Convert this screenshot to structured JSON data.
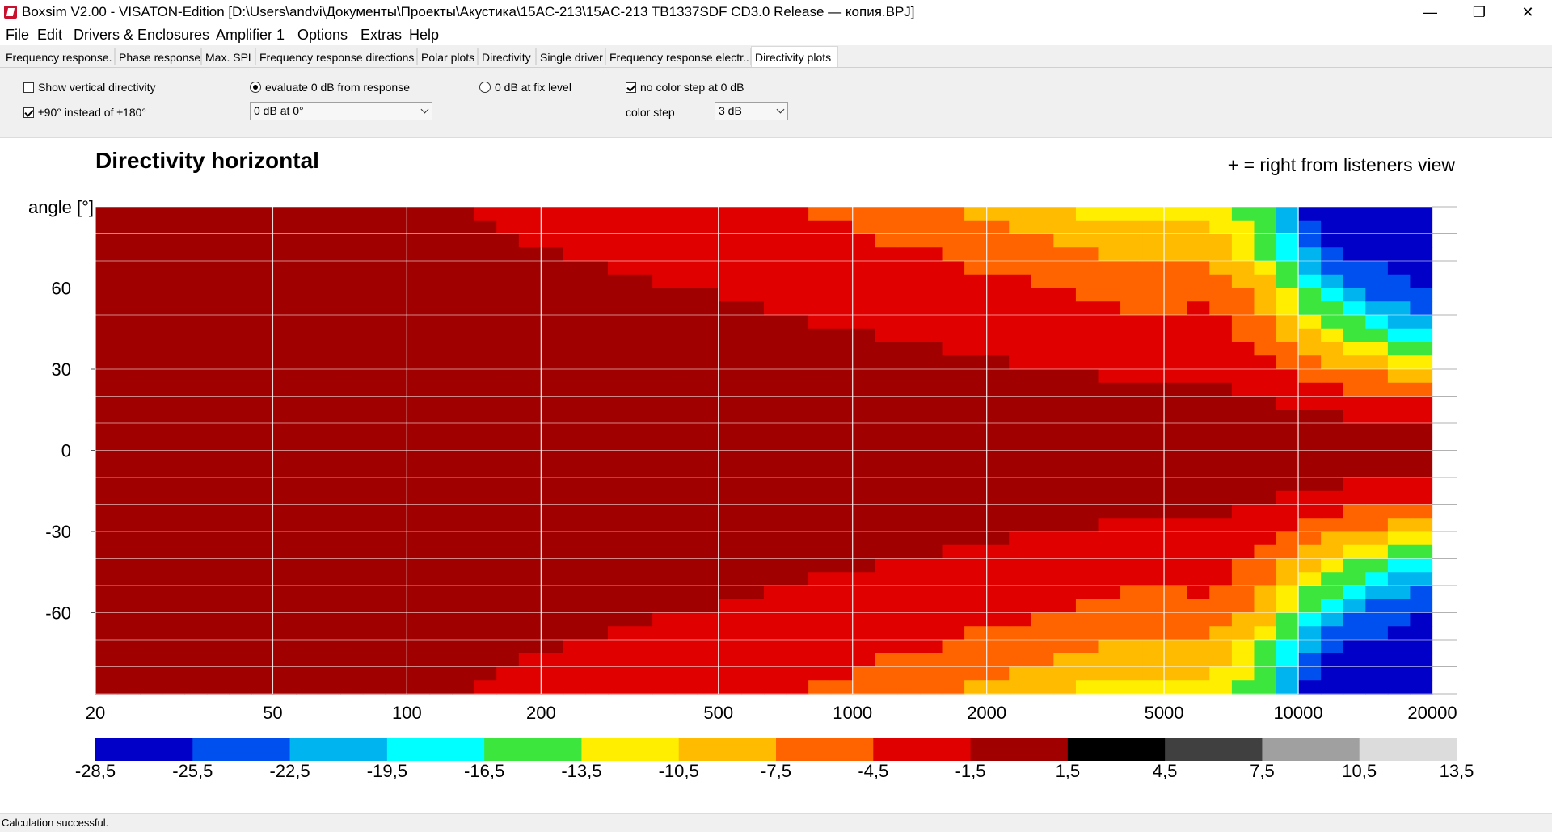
{
  "window": {
    "title": "Boxsim V2.00 - VISATON-Edition [D:\\Users\\andvi\\Документы\\Проекты\\Акустика\\15AC-213\\15AC-213 TB1337SDF CD3.0 Release — копия.BPJ]",
    "minimize_glyph": "—",
    "maximize_glyph": "❐",
    "close_glyph": "✕"
  },
  "menu": [
    "File",
    "Edit",
    "Drivers & Enclosures",
    "Amplifier 1",
    "Options",
    "Extras",
    "Help"
  ],
  "tabs": [
    {
      "label": "Frequency response."
    },
    {
      "label": "Phase response"
    },
    {
      "label": "Max. SPL"
    },
    {
      "label": "Frequency response directions"
    },
    {
      "label": "Polar plots"
    },
    {
      "label": "Directivity"
    },
    {
      "label": "Single driver"
    },
    {
      "label": "Frequency response electr.."
    },
    {
      "label": "Directivity plots",
      "active": true
    }
  ],
  "options": {
    "show_vertical": {
      "label": "Show vertical directivity",
      "checked": false
    },
    "plus_minus_90": {
      "label": "±90° instead of ±180°",
      "checked": true
    },
    "evaluate_0db": {
      "label": "evaluate 0 dB from response",
      "selected": true
    },
    "ref_select": {
      "value": "0 dB at 0°"
    },
    "fix_level": {
      "label": "0 dB at fix level",
      "selected": false
    },
    "no_color_step": {
      "label": "no color step at 0 dB",
      "checked": true
    },
    "color_step_label": "color step",
    "color_step_select": {
      "value": "3 dB"
    }
  },
  "chart_data": {
    "type": "heatmap",
    "title": "Directivity horizontal",
    "note": "+ = right from listeners view",
    "ylabel": "angle [°]",
    "x_scale": "log",
    "xlim": [
      20,
      20000
    ],
    "x_ticks": [
      "20",
      "50",
      "100",
      "200",
      "500",
      "1000",
      "2000",
      "5000",
      "10000",
      "20000"
    ],
    "x_tick_values": [
      20,
      50,
      100,
      200,
      500,
      1000,
      2000,
      5000,
      10000,
      20000
    ],
    "ylim": [
      -90,
      90
    ],
    "y_ticks": [
      "60",
      "30",
      "0",
      "-30",
      "-60"
    ],
    "y_tick_values": [
      60,
      30,
      0,
      -30,
      -60
    ],
    "grid": true,
    "colorbar": {
      "colors": [
        "#0000c8",
        "#0050f0",
        "#00b4f0",
        "#00ffff",
        "#3ce63c",
        "#ffee00",
        "#ffbb00",
        "#ff6400",
        "#e10000",
        "#a00000",
        "#000000",
        "#404040",
        "#a0a0a0",
        "#dcdcdc"
      ],
      "labels": [
        "-28,5",
        "-25,5",
        "-22,5",
        "-19,5",
        "-16,5",
        "-13,5",
        "-10,5",
        "-7,5",
        "-4,5",
        "-1,5",
        "1,5",
        "4,5",
        "7,5",
        "10,5",
        "13,5"
      ]
    },
    "contours_db_vs_freq": {
      "angles_deg": [
        90,
        75,
        60,
        45,
        30,
        15,
        0
      ],
      "freqs_hz": [
        20,
        50,
        100,
        150,
        200,
        300,
        500,
        700,
        1000,
        1500,
        2000,
        3000,
        4000,
        5000,
        6000,
        7000,
        8000,
        9000,
        10000,
        12000,
        15000,
        20000
      ],
      "levels_db": [
        [
          -0.5,
          -0.8,
          -1.2,
          -1.6,
          -2.0,
          -2.6,
          -3.3,
          -4.2,
          -5.5,
          -7.0,
          -8.5,
          -10.5,
          -12.0,
          -12.0,
          -11.0,
          -13.0,
          -15.0,
          -18.0,
          -26.0,
          -28.0,
          -28.0,
          -27.0
        ],
        [
          -0.4,
          -0.6,
          -0.9,
          -1.2,
          -1.5,
          -1.9,
          -2.4,
          -3.0,
          -3.8,
          -4.8,
          -5.8,
          -7.0,
          -8.5,
          -9.0,
          -8.0,
          -10.0,
          -13.0,
          -16.0,
          -22.0,
          -26.0,
          -27.0,
          -27.0
        ],
        [
          -0.3,
          -0.4,
          -0.6,
          -0.8,
          -1.0,
          -1.3,
          -1.6,
          -2.0,
          -2.5,
          -3.0,
          -3.6,
          -4.4,
          -5.5,
          -6.0,
          -5.2,
          -6.5,
          -8.5,
          -11.0,
          -15.0,
          -20.0,
          -24.0,
          -26.0
        ],
        [
          -0.2,
          -0.25,
          -0.35,
          -0.5,
          -0.6,
          -0.75,
          -0.95,
          -1.2,
          -1.5,
          -1.9,
          -2.3,
          -2.9,
          -3.5,
          -3.8,
          -3.3,
          -4.2,
          -5.5,
          -7.0,
          -9.5,
          -13.0,
          -17.0,
          -21.0
        ],
        [
          -0.1,
          -0.12,
          -0.18,
          -0.25,
          -0.3,
          -0.38,
          -0.48,
          -0.6,
          -0.75,
          -1.0,
          -1.2,
          -1.55,
          -1.9,
          -2.1,
          -1.8,
          -2.3,
          -2.9,
          -3.6,
          -4.8,
          -6.5,
          -8.5,
          -11.0
        ],
        [
          0,
          -0.03,
          -0.05,
          -0.07,
          -0.08,
          -0.1,
          -0.12,
          -0.15,
          -0.2,
          -0.25,
          -0.3,
          -0.4,
          -0.5,
          -0.55,
          -0.45,
          -0.6,
          -0.8,
          -1.0,
          -1.3,
          -1.8,
          -2.3,
          -3.0
        ],
        [
          0,
          0,
          0,
          0,
          0,
          0,
          0,
          0,
          0,
          0,
          0,
          0,
          0,
          0,
          0,
          0,
          0,
          0,
          0,
          0,
          0,
          0
        ]
      ]
    }
  },
  "status": {
    "text": "Calculation successful."
  }
}
